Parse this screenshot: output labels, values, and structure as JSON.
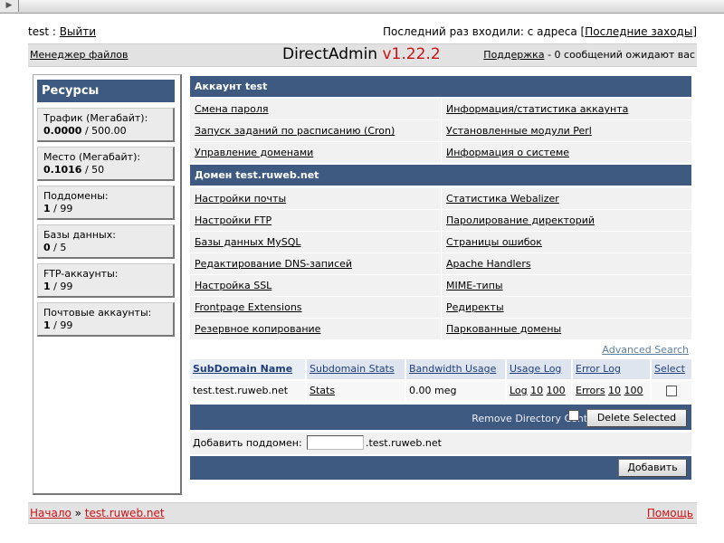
{
  "header": {
    "user": "test",
    "sep": ":",
    "logout": "Выйти",
    "last_login_prefix": "Последний раз входили: с адреса",
    "last_logins": "Последние заходы",
    "file_manager": "Менеджер файлов",
    "brand": "DirectAdmin",
    "version": "v1.22.2",
    "support": "Поддержка",
    "messages": "- 0 сообщений ожидают вас"
  },
  "sidebar": {
    "title": "Ресурсы",
    "items": [
      {
        "label": "Трафик (Мегабайт):",
        "used": "0.0000",
        "limit": "500.00"
      },
      {
        "label": "Место (Мегабайт):",
        "used": "0.1016",
        "limit": "50"
      },
      {
        "label": "Поддомены:",
        "used": "1",
        "limit": "99"
      },
      {
        "label": "Базы данных:",
        "used": "0",
        "limit": "5"
      },
      {
        "label": "FTP-аккаунты:",
        "used": "1",
        "limit": "99"
      },
      {
        "label": "Почтовые аккаунты:",
        "used": "1",
        "limit": "99"
      }
    ]
  },
  "account": {
    "title": "Аккаунт test",
    "rows": [
      [
        "Смена пароля",
        "Информация/статистика аккаунта"
      ],
      [
        "Запуск заданий по расписанию (Cron)",
        "Установленные модули Perl"
      ],
      [
        "Управление доменами",
        "Информация о системе"
      ]
    ]
  },
  "domain": {
    "title": "Домен test.ruweb.net",
    "rows": [
      [
        "Настройки почты",
        "Статистика Webalizer"
      ],
      [
        "Настройки FTP",
        "Паролирование директорий"
      ],
      [
        "Базы данных MySQL",
        "Страницы ошибок"
      ],
      [
        "Редактирование DNS-записей",
        "Apache Handlers"
      ],
      [
        "Настройка SSL",
        "MIME-типы"
      ],
      [
        "Frontpage Extensions",
        "Редиректы"
      ],
      [
        "Резервное копирование",
        "Паркованные домены"
      ]
    ]
  },
  "subdomains": {
    "advanced_search": "Advanced Search",
    "columns": [
      "SubDomain Name",
      "Subdomain Stats",
      "Bandwidth Usage",
      "Usage Log",
      "Error Log",
      "Select"
    ],
    "row": {
      "name": "test.test.ruweb.net",
      "stats": "Stats",
      "bandwidth": "0.00 meg",
      "usage_log": "Log",
      "usage_10": "10",
      "usage_100": "100",
      "error_log": "Errors",
      "error_10": "10",
      "error_100": "100"
    },
    "remove_dir_label": "Remove Directory Contents",
    "delete_selected": "Delete Selected",
    "add_label": "Добавить поддомен:",
    "add_input_value": "",
    "add_suffix": ".test.ruweb.net",
    "add_button": "Добавить"
  },
  "footer": {
    "home": "Начало",
    "sep": "»",
    "domain": "test.ruweb.net",
    "help": "Помощь"
  }
}
